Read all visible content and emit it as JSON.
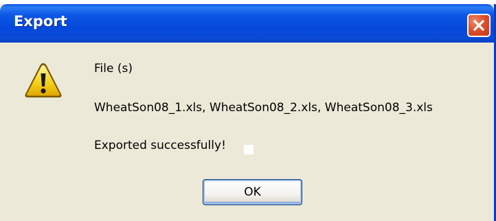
{
  "window": {
    "title": "Export",
    "close_icon": "close-icon",
    "title_bar_color": "#0548dc",
    "close_button_color": "#e0502c"
  },
  "dialog": {
    "icon": "warning-icon",
    "line1": "File (s)",
    "line2": "WheatSon08_1.xls, WheatSon08_2.xls, WheatSon08_3.xls",
    "line3": "Exported successfully!",
    "background_color": "#ece9d8"
  },
  "buttons": {
    "ok_label": "OK"
  }
}
